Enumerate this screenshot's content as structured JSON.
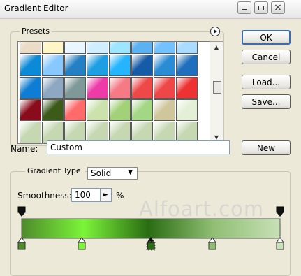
{
  "window": {
    "title": "Gradient Editor",
    "controls": [
      "minimize-icon",
      "maximize-icon",
      "close-icon"
    ]
  },
  "presets": {
    "label": "Presets",
    "menu_icon": "play-circle-icon",
    "swatches": [
      [
        "#eadcc7",
        "#fff6c8",
        "#e9f6ff",
        "#cfeeff",
        "#9ee6ff",
        "#5bb2f2",
        "#73c2ff",
        "#a9dcff"
      ],
      [
        "#0b8ad8",
        "#87c9ff",
        "#2480c4",
        "#1f9fe3",
        "#25b5ff",
        "#155ba7",
        "#2b8cd6",
        "#1e6fbd"
      ],
      [
        "#0f7dd3",
        "#8ea7c2",
        "#7f9898",
        "#ee3ba8",
        "#f57a86",
        "#ef4848",
        "#ef4747",
        "#ee3131"
      ],
      [
        "#8a0b1b",
        "#3c5b19",
        "#ff6b6b",
        "#cbe2ad",
        "#a3d178",
        "#a3d785",
        "#cfc79b",
        "#e3f0d6"
      ],
      [
        "#c6d8b2",
        "#c6d8b2",
        "#c6d8b2",
        "#c6d8b2",
        "#c6d8b2",
        "#c6d8b2",
        "#c6d8b2",
        "#c6d8b2"
      ]
    ]
  },
  "buttons": {
    "ok": "OK",
    "cancel": "Cancel",
    "load": "Load...",
    "save": "Save...",
    "new": "New"
  },
  "name": {
    "label": "Name:",
    "value": "Custom"
  },
  "gradient_type": {
    "label": "Gradient Type:",
    "value": "Solid"
  },
  "smoothness": {
    "label": "Smoothness:",
    "value": "100",
    "unit": "%"
  },
  "watermark": "Alfoart.com",
  "gradient_bar": {
    "stops": [
      {
        "position": 0.0,
        "color": "#4e8b2b"
      },
      {
        "position": 0.24,
        "color": "#7cf43a"
      },
      {
        "position": 0.49,
        "color": "#2a6c12"
      },
      {
        "position": 0.74,
        "color": "#8fbe73"
      },
      {
        "position": 1.0,
        "color": "#c8e0b6"
      }
    ]
  },
  "stops_labels": {
    "icons": [
      "opacity-stop-icon",
      "color-stop-icon"
    ]
  }
}
